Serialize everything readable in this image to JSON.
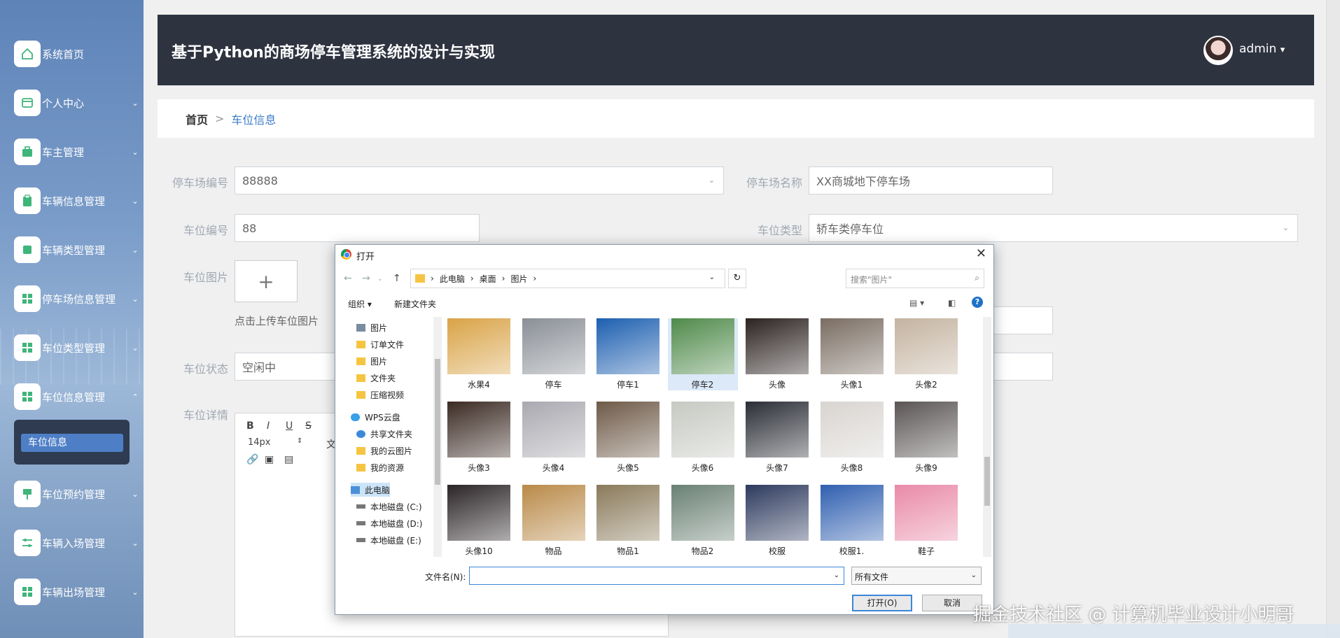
{
  "header": {
    "title": "基于Python的商场停车管理系统的设计与实现",
    "user": "admin",
    "user_caret": "▾"
  },
  "sidebar": {
    "items": [
      {
        "label": "系统首页",
        "icon": "home-icon",
        "chevron": ""
      },
      {
        "label": "个人中心",
        "icon": "card-icon",
        "chevron": "⌄"
      },
      {
        "label": "车主管理",
        "icon": "briefcase-icon",
        "chevron": "⌄"
      },
      {
        "label": "车辆信息管理",
        "icon": "clipboard-icon",
        "chevron": "⌄"
      },
      {
        "label": "车辆类型管理",
        "icon": "box-icon",
        "chevron": "⌄"
      },
      {
        "label": "停车场信息管理",
        "icon": "grid-icon",
        "chevron": "⌄"
      },
      {
        "label": "车位类型管理",
        "icon": "grid-icon",
        "chevron": "⌄"
      },
      {
        "label": "车位信息管理",
        "icon": "grid-icon",
        "chevron": "⌃"
      },
      {
        "label": "车位预约管理",
        "icon": "flag-icon",
        "chevron": "⌄"
      },
      {
        "label": "车辆入场管理",
        "icon": "sliders-icon",
        "chevron": "⌄"
      },
      {
        "label": "车辆出场管理",
        "icon": "grid-icon",
        "chevron": "⌄"
      }
    ],
    "submenu_active": "车位信息"
  },
  "breadcrumb": {
    "home": "首页",
    "sep": ">",
    "current": "车位信息"
  },
  "form": {
    "lot_no_label": "停车场编号",
    "lot_no_value": "88888",
    "lot_name_label": "停车场名称",
    "lot_name_value": "XX商城地下停车场",
    "space_no_label": "车位编号",
    "space_no_value": "88",
    "space_type_label": "车位类型",
    "space_type_value": "轿车类停车位",
    "space_image_label": "车位图片",
    "upload_plus": "+",
    "upload_hint": "点击上传车位图片",
    "status_label": "车位状态",
    "status_value": "空闲中",
    "detail_label": "车位详情",
    "editor_font_size": "14px",
    "editor_text_btn": "文"
  },
  "dialog": {
    "title": "打开",
    "close": "✕",
    "path": [
      "此电脑",
      "桌面",
      "图片"
    ],
    "search_placeholder": "搜索\"图片\"",
    "organize": "组织 ▾",
    "new_folder": "新建文件夹",
    "help": "?",
    "tree": [
      {
        "label": "图片",
        "type": "pic"
      },
      {
        "label": "订单文件",
        "type": "folder"
      },
      {
        "label": "图片",
        "type": "folder"
      },
      {
        "label": "文件夹",
        "type": "folder"
      },
      {
        "label": "压缩视频",
        "type": "folder"
      },
      {
        "label": "WPS云盘",
        "type": "cloud"
      },
      {
        "label": "共享文件夹",
        "type": "share"
      },
      {
        "label": "我的云图片",
        "type": "folder"
      },
      {
        "label": "我的资源",
        "type": "folder"
      },
      {
        "label": "此电脑",
        "type": "pc"
      },
      {
        "label": "本地磁盘 (C:)",
        "type": "disk"
      },
      {
        "label": "本地磁盘 (D:)",
        "type": "disk"
      },
      {
        "label": "本地磁盘 (E:)",
        "type": "disk"
      }
    ],
    "files": [
      {
        "name": "水果4",
        "color": "#d9a347"
      },
      {
        "name": "停车",
        "color": "#8a8f96"
      },
      {
        "name": "停车1",
        "color": "#1d5fb0"
      },
      {
        "name": "停车2",
        "color": "#4f8a4a"
      },
      {
        "name": "头像",
        "color": "#2b2220"
      },
      {
        "name": "头像1",
        "color": "#7a6d62"
      },
      {
        "name": "头像2",
        "color": "#c4b3a0"
      },
      {
        "name": "头像3",
        "color": "#3b2a23"
      },
      {
        "name": "头像4",
        "color": "#a9a9b0"
      },
      {
        "name": "头像5",
        "color": "#6e5a48"
      },
      {
        "name": "头像6",
        "color": "#c6c9c2"
      },
      {
        "name": "头像7",
        "color": "#2a2d35"
      },
      {
        "name": "头像8",
        "color": "#d8d4d0"
      },
      {
        "name": "头像9",
        "color": "#5a5554"
      },
      {
        "name": "头像10",
        "color": "#2a2426"
      },
      {
        "name": "物品",
        "color": "#b98a48"
      },
      {
        "name": "物品1",
        "color": "#8a7a5a"
      },
      {
        "name": "物品2",
        "color": "#6a8074"
      },
      {
        "name": "校服",
        "color": "#2d3a5e"
      },
      {
        "name": "校服1.",
        "color": "#2f5fb0"
      },
      {
        "name": "鞋子",
        "color": "#e98aa8"
      }
    ],
    "filename_label": "文件名(N):",
    "filetype_value": "所有文件",
    "open_btn": "打开(O)",
    "cancel_btn": "取消"
  },
  "watermark": "掘金技术社区 @ 计算机毕业设计小明哥"
}
